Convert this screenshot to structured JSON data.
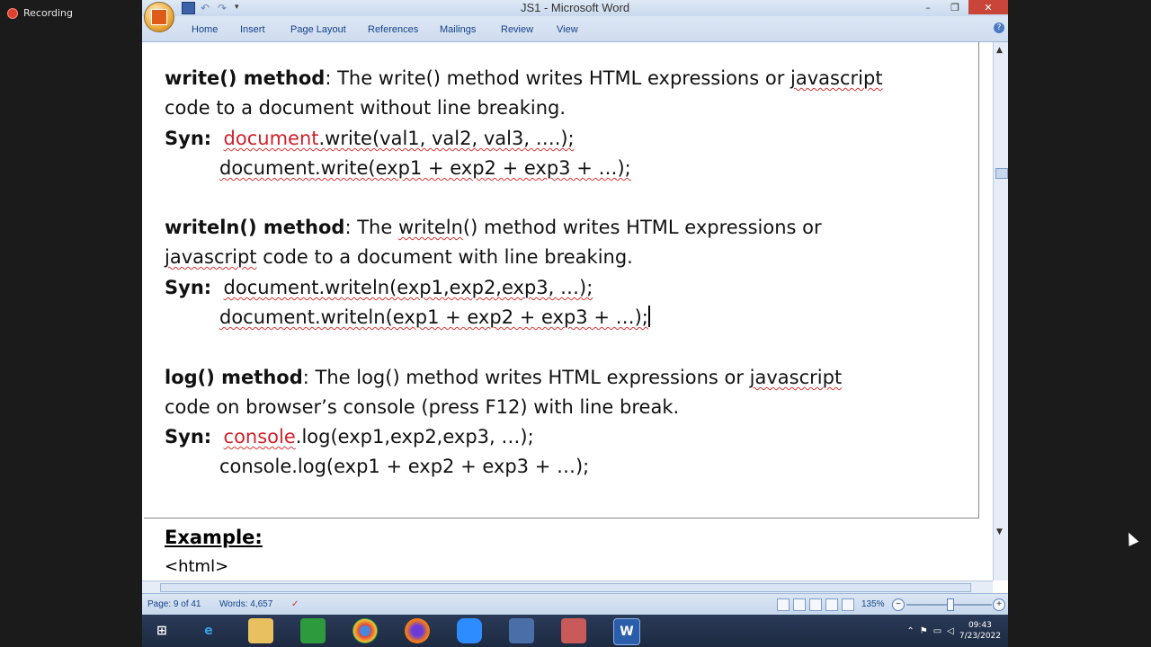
{
  "recording": {
    "label": "Recording"
  },
  "window": {
    "title": "JS1 - Microsoft Word"
  },
  "menu": {
    "items": [
      "Home",
      "Insert",
      "Page Layout",
      "References",
      "Mailings",
      "Review",
      "View"
    ]
  },
  "doc": {
    "p1_bold": "write() method",
    "p1_rest": ": The write() method writes HTML expressions or ",
    "p1_sq": "javascript",
    "p1_line2": "code to a document without line breaking.",
    "syn_label": "Syn:",
    "p1_syn1_red": "document",
    "p1_syn1_rest": ".write(val1, val2, val3, ….);",
    "p1_syn2": "document.write(exp1 + exp2 + exp3 + …);",
    "p2_bold": "writeln() method",
    "p2_rest1": ": The ",
    "p2_sq": "writeln",
    "p2_rest2": "() method writes HTML expressions or",
    "p2_line2_sq": "javascript",
    "p2_line2_rest": " code to a document with line breaking.",
    "p2_syn1": "document.writeln(exp1,exp2,exp3, …);",
    "p2_syn2": "document.writeln(exp1 + exp2 + exp3 + …);",
    "p3_bold": "log() method",
    "p3_rest": ": The log() method writes HTML expressions or ",
    "p3_sq": "javascript",
    "p3_line2": "code on browser’s console (press F12) with line break.",
    "p3_syn1_red": "console",
    "p3_syn1_rest": ".log(exp1,exp2,exp3, …);",
    "p3_syn2": "console.log(exp1 + exp2 + exp3 + …);",
    "example": "Example:",
    "html_tag": "<html>"
  },
  "status": {
    "page": "Page: 9 of 41",
    "words": "Words: 4,657",
    "zoom": "135%"
  },
  "clock": {
    "time": "09:43",
    "date": "7/23/2022"
  }
}
